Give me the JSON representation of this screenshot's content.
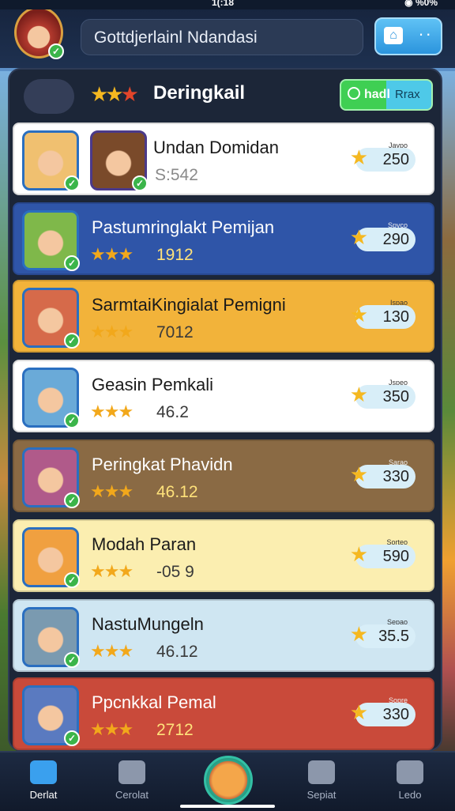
{
  "status_bar": {
    "time": "1(:18",
    "battery": "◉ %0%"
  },
  "top_bar": {
    "title": "Gottdjerlainl Ndandasi"
  },
  "leaderboard": {
    "title": "Deringkail",
    "toggle": {
      "left_label": "hadl",
      "right_label": "Rrax"
    }
  },
  "rows": [
    {
      "name": "Undan Domidan",
      "score_text": "S:542",
      "points": "250",
      "points_label": "Jaypo",
      "bg": "#ffffff",
      "name_color": "#1a1a1a"
    },
    {
      "name": "Pastumringlakt Pemijan",
      "score_text": "1912",
      "points": "290",
      "points_label": "Spyco",
      "bg": "#2f55a8",
      "name_color": "#ffffff"
    },
    {
      "name": "SarmtaiKingialat Pemigni",
      "score_text": "7012",
      "points": "130",
      "points_label": "Ispao",
      "bg": "#f2b33a",
      "name_color": "#1a1a1a"
    },
    {
      "name": "Geasin Pemkali",
      "score_text": "46.2",
      "points": "350",
      "points_label": "Jspeo",
      "bg": "#ffffff",
      "name_color": "#1a1a1a"
    },
    {
      "name": "Peringkat Phavidn",
      "score_text": "46.12",
      "points": "330",
      "points_label": "Sarao",
      "bg": "#8a6a44",
      "name_color": "#ffffff"
    },
    {
      "name": "Modah Paran",
      "score_text": "-05 9",
      "points": "590",
      "points_label": "Sorteo",
      "bg": "#fbeeb0",
      "name_color": "#1a1a1a"
    },
    {
      "name": "NastuMungeln",
      "score_text": "46.12",
      "points": "35.5",
      "points_label": "Sepao",
      "bg": "#cfe6f2",
      "name_color": "#1a1a1a"
    },
    {
      "name": "Ppcnkkal Pemal",
      "score_text": "2712",
      "points": "330",
      "points_label": "Sopre",
      "bg": "#c94a3a",
      "name_color": "#ffffff"
    }
  ],
  "bottom_nav": {
    "items": [
      {
        "label": "Derlat"
      },
      {
        "label": "Cerolat"
      },
      {
        "label": "Sepiat"
      },
      {
        "label": "Ledo"
      }
    ]
  }
}
